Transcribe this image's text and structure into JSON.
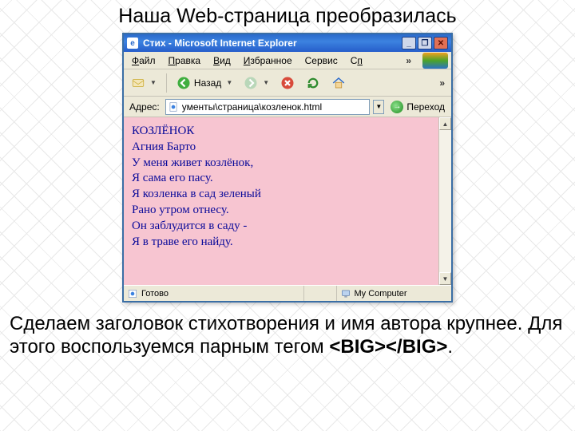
{
  "heading": "Наша Web-страница преобразилась",
  "window": {
    "title": "Стих - Microsoft Internet Explorer",
    "minimize": "_",
    "restore": "❐",
    "close": "✕"
  },
  "menu": {
    "file": "Файл",
    "edit": "Правка",
    "view": "Вид",
    "favorites": "Избранное",
    "tools": "Сервис",
    "help_cut": "Сп",
    "overflow": "»"
  },
  "toolbar": {
    "back_label": "Назад",
    "overflow": "»"
  },
  "address": {
    "label": "Адрес:",
    "value": "ументы\\страница\\козленок.html",
    "go_label": "Переход"
  },
  "page": {
    "l1": "КОЗЛЁНОК",
    "l2": "Агния Барто",
    "l3": "У меня живет козлёнок,",
    "l4": "Я сама его пасу.",
    "l5": "Я козленка в сад зеленый",
    "l6": "Рано утром отнесу.",
    "l7": "Он заблудится в саду -",
    "l8": "Я в траве его найду."
  },
  "status": {
    "left": "Готово",
    "right": "My Computer"
  },
  "body_text": {
    "p1a": "Сделаем заголовок стихотворения и имя автора крупнее. Для этого воспользуемся парным тегом ",
    "tag": "<BIG></BIG>",
    "p1b": "."
  }
}
